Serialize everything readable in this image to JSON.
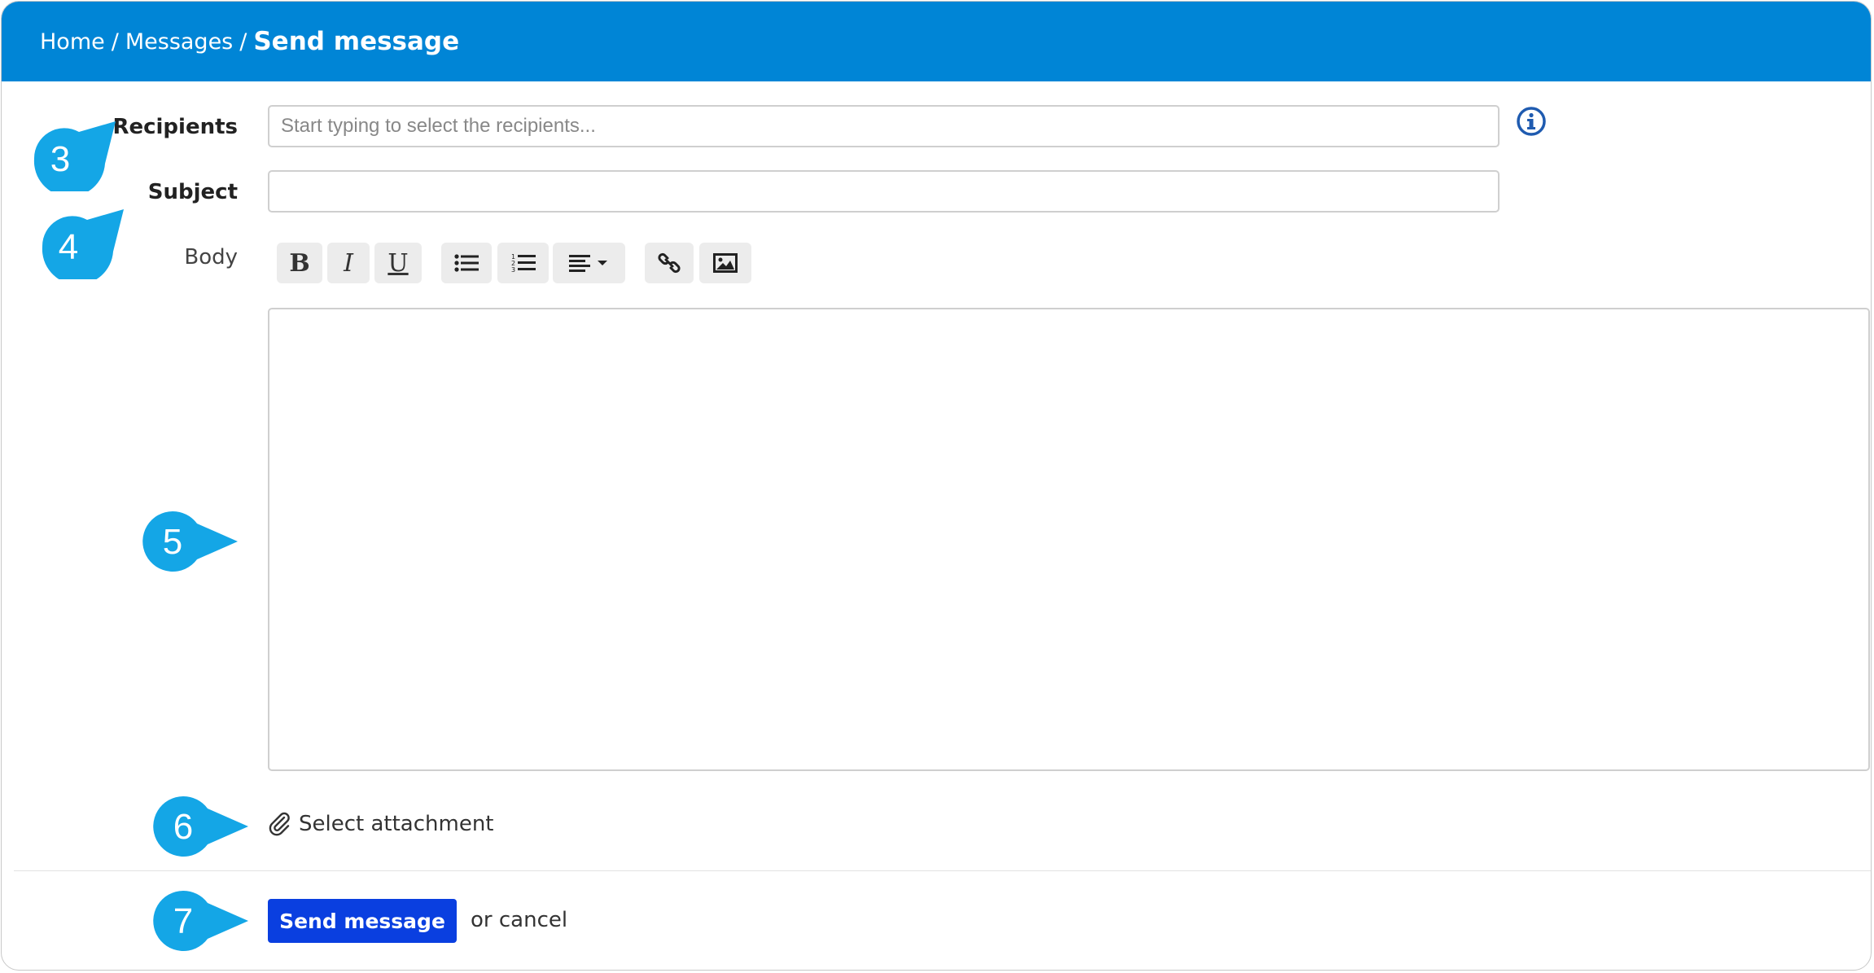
{
  "breadcrumb": {
    "home": "Home",
    "separator": "/",
    "messages": "Messages",
    "current": "Send message"
  },
  "form": {
    "recipients_label": "Recipients",
    "recipients_placeholder": "Start typing to select the recipients...",
    "recipients_value": "",
    "subject_label": "Subject",
    "subject_value": "",
    "body_label": "Body",
    "body_value": ""
  },
  "toolbar": {
    "bold_label": "B",
    "italic_label": "I",
    "underline_label": "U",
    "icons": [
      "bulleted-list-icon",
      "numbered-list-icon",
      "align-left-dropdown-icon",
      "link-icon",
      "image-icon"
    ]
  },
  "attachment": {
    "label": "Select attachment",
    "icon": "paperclip-icon"
  },
  "actions": {
    "send_label": "Send message",
    "or_text": "or",
    "cancel_label": "cancel"
  },
  "callouts": [
    "3",
    "4",
    "5",
    "6",
    "7"
  ],
  "colors": {
    "header": "#0085d6",
    "send_button": "#0a3fe0",
    "callout": "#14a6e6",
    "info_icon": "#1f5bb0"
  }
}
